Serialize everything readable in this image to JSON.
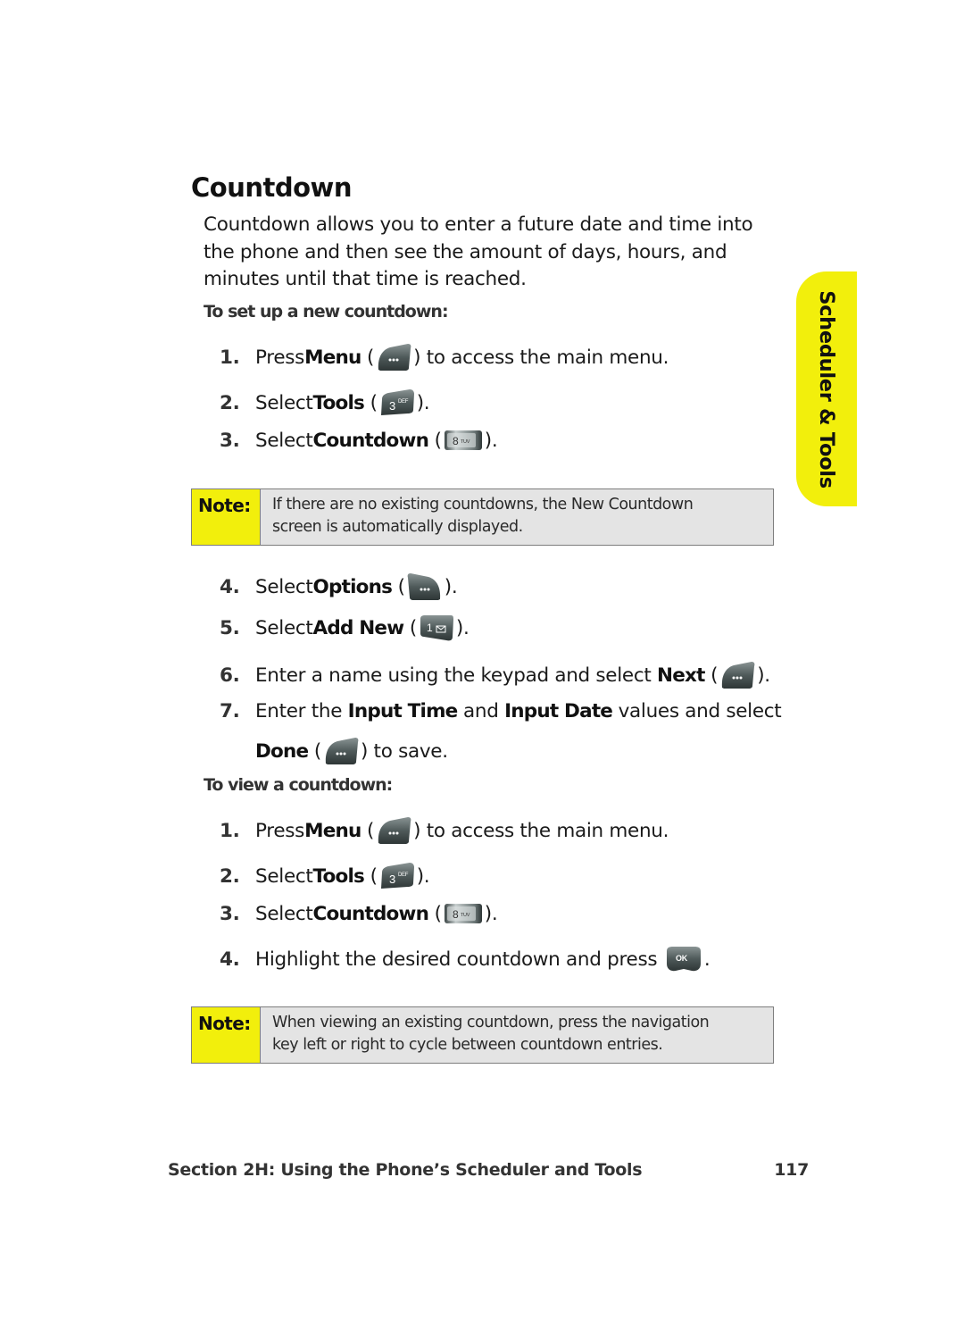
{
  "page": {
    "title": "Countdown",
    "intro": "Countdown allows you to enter a future date and time into the phone and then see the amount of days, hours, and minutes until that time is reached.",
    "side_tab": "Scheduler & Tools",
    "colors": {
      "accent_yellow": "#f2ef0c",
      "note_bg": "#e4e4e4",
      "note_border": "#7d7d7d"
    }
  },
  "setup": {
    "heading": "To set up a new countdown:",
    "steps": [
      {
        "num": "1.",
        "pre": "Press ",
        "bold": "Menu",
        "open": " (",
        "icon": "menu-softkey-left-icon",
        "post": ") to access the main menu."
      },
      {
        "num": "2.",
        "pre": "Select ",
        "bold": "Tools",
        "open": " (",
        "icon": "key-3-def-icon",
        "key_label": "3",
        "key_sub": "DEF",
        "post": ")."
      },
      {
        "num": "3.",
        "pre": "Select ",
        "bold": "Countdown",
        "open": " (",
        "icon": "key-8-tuv-icon",
        "key_label": "8",
        "key_sub": "TUV",
        "post": ")."
      },
      {
        "num": "4.",
        "pre": "Select ",
        "bold": "Options",
        "open": " (",
        "icon": "options-softkey-right-icon",
        "post": ")."
      },
      {
        "num": "5.",
        "pre": "Select ",
        "bold": "Add New",
        "open": " (",
        "icon": "key-1-envelope-icon",
        "key_label": "1",
        "post": ")."
      },
      {
        "num": "6.",
        "pre": "Enter a name using the keypad and select ",
        "bold": "Next",
        "open": " (",
        "icon": "menu-softkey-left-icon",
        "post": ")."
      },
      {
        "num": "7.",
        "pre": "Enter the ",
        "bold": "Input Time",
        "mid": " and ",
        "bold2": "Input Date",
        "post": " values and select",
        "line2_bold": "Done",
        "line2_open": " (",
        "line2_icon": "menu-softkey-left-icon",
        "line2_post": ") to save."
      }
    ],
    "note": {
      "label": "Note:",
      "text_line1": "If there are no existing countdowns, the New Countdown",
      "text_line2": "screen is automatically displayed."
    }
  },
  "view": {
    "heading": "To view a countdown:",
    "steps": [
      {
        "num": "1.",
        "pre": "Press ",
        "bold": "Menu",
        "open": " (",
        "icon": "menu-softkey-left-icon",
        "post": ") to access the main menu."
      },
      {
        "num": "2.",
        "pre": "Select ",
        "bold": "Tools",
        "open": " (",
        "icon": "key-3-def-icon",
        "key_label": "3",
        "key_sub": "DEF",
        "post": ")."
      },
      {
        "num": "3.",
        "pre": "Select ",
        "bold": "Countdown",
        "open": " (",
        "icon": "key-8-tuv-icon",
        "key_label": "8",
        "key_sub": "TUV",
        "post": ")."
      },
      {
        "num": "4.",
        "pre": "Highlight the desired countdown and press ",
        "icon": "ok-key-icon",
        "key_label": "OK",
        "post": "."
      }
    ],
    "note": {
      "label": "Note:",
      "text_line1": "When viewing an existing countdown, press the navigation",
      "text_line2": "key left or right to cycle between countdown entries."
    }
  },
  "footer": {
    "section": "Section 2H: Using the Phone’s Scheduler and Tools",
    "page_number": "117"
  }
}
